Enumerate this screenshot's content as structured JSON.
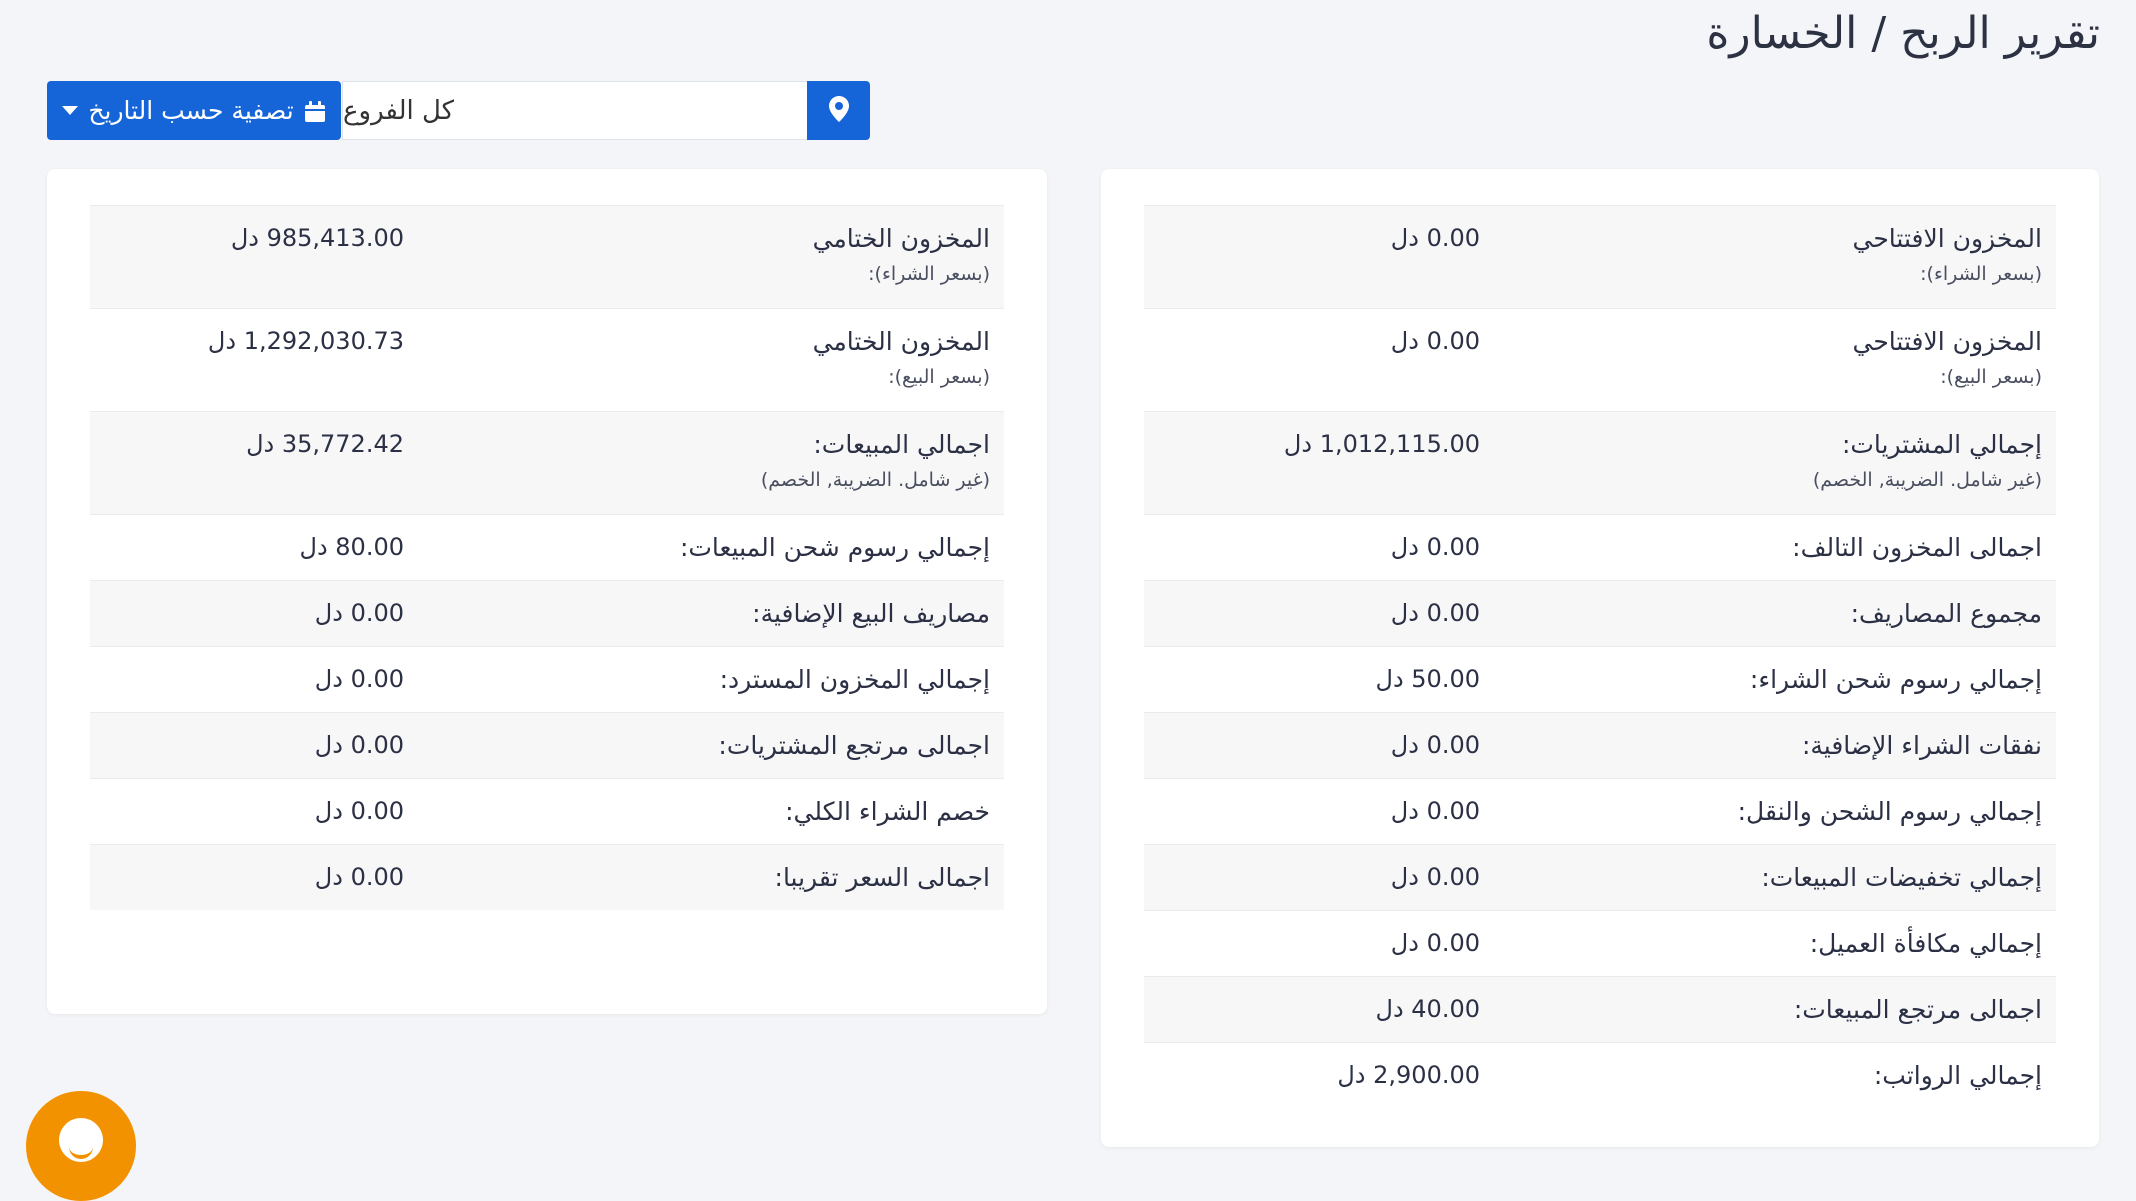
{
  "page": {
    "title": "تقرير الربح / الخسارة"
  },
  "filters": {
    "date_filter_label": "تصفية حسب التاريخ",
    "branch_value": "كل الفروع"
  },
  "colors": {
    "primary": "#1565d8",
    "chat_bubble": "#f39200",
    "background": "#f4f5f8"
  },
  "icons": {
    "date_filter": "calendar-icon",
    "dropdown": "caret-down-icon",
    "location": "map-marker-icon",
    "chat": "chat-icon"
  },
  "left_card": {
    "rows": [
      {
        "label": "المخزون الختامي",
        "sub": "(بسعر الشراء):",
        "value": "985,413.00 دل"
      },
      {
        "label": "المخزون الختامي",
        "sub": "(بسعر البيع):",
        "value": "1,292,030.73 دل"
      },
      {
        "label": "اجمالي المبيعات:",
        "sub": "(غير شامل. الضريبة, الخصم)",
        "value": "35,772.42 دل"
      },
      {
        "label": "إجمالي رسوم شحن المبيعات:",
        "sub": "",
        "value": "80.00 دل"
      },
      {
        "label": "مصاريف البيع الإضافية:",
        "sub": "",
        "value": "0.00 دل"
      },
      {
        "label": "إجمالي المخزون المسترد:",
        "sub": "",
        "value": "0.00 دل"
      },
      {
        "label": "اجمالى مرتجع المشتريات:",
        "sub": "",
        "value": "0.00 دل"
      },
      {
        "label": "خصم الشراء الكلي:",
        "sub": "",
        "value": "0.00 دل"
      },
      {
        "label": "اجمالى السعر تقريبا:",
        "sub": "",
        "value": "0.00 دل"
      }
    ]
  },
  "right_card": {
    "rows": [
      {
        "label": "المخزون الافتتاحي",
        "sub": "(بسعر الشراء):",
        "value": "0.00 دل"
      },
      {
        "label": "المخزون الافتتاحي",
        "sub": "(بسعر البيع):",
        "value": "0.00 دل"
      },
      {
        "label": "إجمالي المشتريات:",
        "sub": "(غير شامل. الضريبة, الخصم)",
        "value": "1,012,115.00 دل"
      },
      {
        "label": "اجمالى المخزون التالف:",
        "sub": "",
        "value": "0.00 دل"
      },
      {
        "label": "مجموع المصاريف:",
        "sub": "",
        "value": "0.00 دل"
      },
      {
        "label": "إجمالي رسوم شحن الشراء:",
        "sub": "",
        "value": "50.00 دل"
      },
      {
        "label": "نفقات الشراء الإضافية:",
        "sub": "",
        "value": "0.00 دل"
      },
      {
        "label": "إجمالي رسوم الشحن والنقل:",
        "sub": "",
        "value": "0.00 دل"
      },
      {
        "label": "إجمالي تخفيضات المبيعات:",
        "sub": "",
        "value": "0.00 دل"
      },
      {
        "label": "إجمالي مكافأة العميل:",
        "sub": "",
        "value": "0.00 دل"
      },
      {
        "label": "اجمالى مرتجع المبيعات:",
        "sub": "",
        "value": "40.00 دل"
      },
      {
        "label": "إجمالي الرواتب:",
        "sub": "",
        "value": "2,900.00 دل"
      }
    ]
  }
}
